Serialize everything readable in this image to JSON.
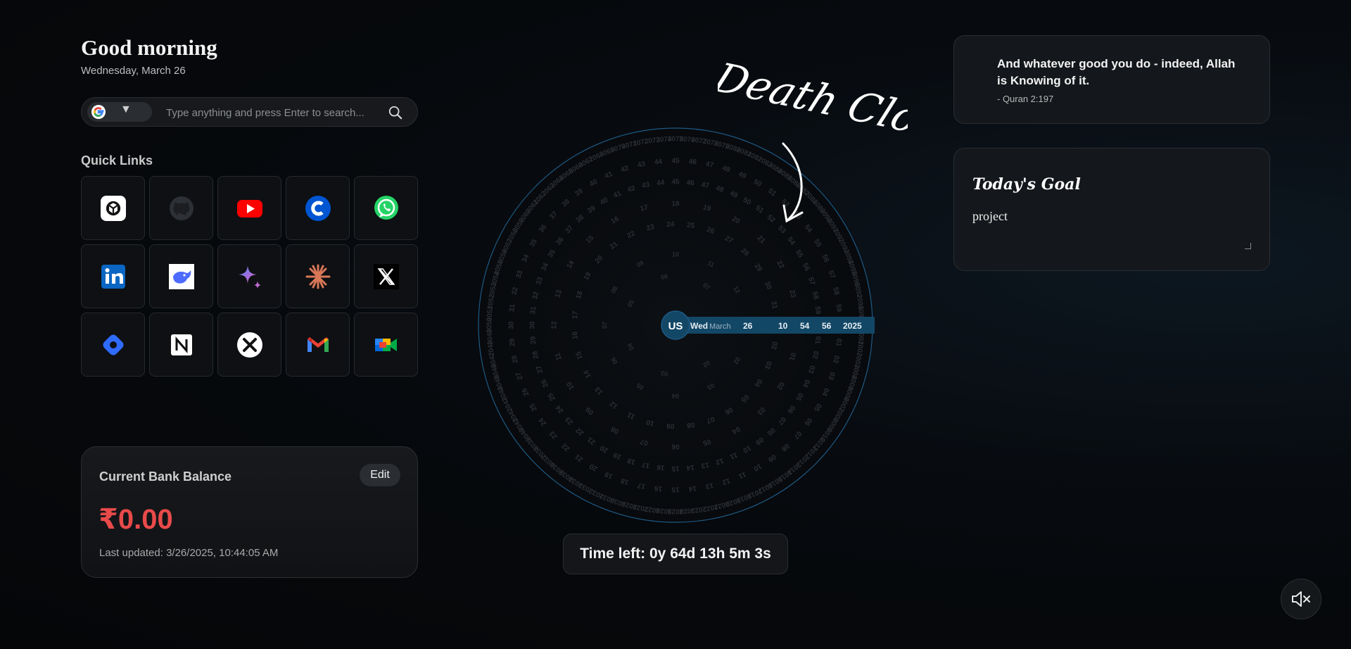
{
  "greeting": {
    "title": "Good morning",
    "date": "Wednesday, March 26"
  },
  "search": {
    "placeholder": "Type anything and press Enter to search...",
    "engine_icon": "google-icon"
  },
  "quick_links": {
    "title": "Quick Links",
    "items": [
      {
        "name": "chatgpt",
        "icon": "chatgpt-icon"
      },
      {
        "name": "github",
        "icon": "github-icon"
      },
      {
        "name": "youtube",
        "icon": "youtube-icon"
      },
      {
        "name": "coursera",
        "icon": "coursera-icon"
      },
      {
        "name": "whatsapp",
        "icon": "whatsapp-icon"
      },
      {
        "name": "linkedin",
        "icon": "linkedin-icon"
      },
      {
        "name": "deepseek",
        "icon": "deepseek-icon"
      },
      {
        "name": "gemini",
        "icon": "gemini-icon"
      },
      {
        "name": "claude",
        "icon": "claude-icon"
      },
      {
        "name": "x",
        "icon": "x-icon"
      },
      {
        "name": "copilot",
        "icon": "copilot-icon"
      },
      {
        "name": "notion",
        "icon": "notion-icon"
      },
      {
        "name": "perplexity",
        "icon": "perplexity-icon"
      },
      {
        "name": "gmail",
        "icon": "gmail-icon"
      },
      {
        "name": "google-meet",
        "icon": "google-meet-icon"
      }
    ]
  },
  "bank": {
    "title": "Current Bank Balance",
    "edit_label": "Edit",
    "amount": "₹0.00",
    "updated": "Last updated: 3/26/2025, 10:44:05 AM"
  },
  "clock": {
    "title": "Death Clock",
    "center_label": "US",
    "current": {
      "weekday": "Wed",
      "month": "March",
      "day": "26",
      "hour": "10",
      "minute": "54",
      "second": "56",
      "year": "2025"
    },
    "time_left": "Time left: 0y 64d 13h 5m 3s"
  },
  "quote": {
    "text": "And whatever good you do - indeed, Allah is Knowing of it.",
    "source": "- Quran 2:197"
  },
  "goal": {
    "title": "Today's Goal :",
    "value": "project"
  },
  "colors": {
    "accent": "#1e5a85",
    "balance": "#e84a4a",
    "highlight_bar": "#134766"
  }
}
